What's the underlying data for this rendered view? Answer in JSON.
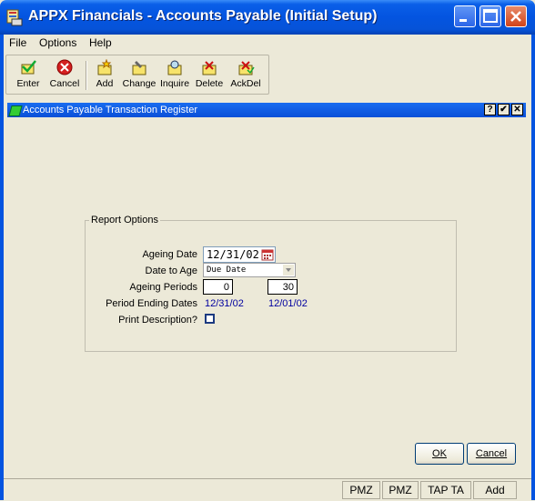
{
  "window": {
    "title": "APPX Financials - Accounts Payable (Initial Setup)"
  },
  "menu": {
    "items": [
      "File",
      "Options",
      "Help"
    ]
  },
  "toolbar": {
    "enter": "Enter",
    "cancel": "Cancel",
    "add": "Add",
    "change": "Change",
    "inquire": "Inquire",
    "delete": "Delete",
    "ackdel": "AckDel"
  },
  "frame": {
    "title": "Accounts Payable Transaction Register",
    "help": "?",
    "ok_icon": "✔",
    "close_icon": "✕"
  },
  "report_options": {
    "title": "Report Options",
    "ageing_date_label": "Ageing Date",
    "ageing_date_value": "12/31/02",
    "date_to_age_label": "Date to Age",
    "date_to_age_value": "Due Date",
    "ageing_periods_label": "Ageing Periods",
    "ageing_period_1": "0",
    "ageing_period_2": "30",
    "period_ending_label": "Period Ending Dates",
    "period_ending_1": "12/31/02",
    "period_ending_2": "12/01/02",
    "print_desc_label": "Print Description?"
  },
  "buttons": {
    "ok": "OK",
    "cancel": "Cancel"
  },
  "status": {
    "s1": "PMZ",
    "s2": "PMZ",
    "s3": "TAP TA",
    "s4": "Add"
  },
  "colors": {
    "titlebar": "#0454e0",
    "value_blue": "#0000a0",
    "face": "#ece9d8"
  }
}
